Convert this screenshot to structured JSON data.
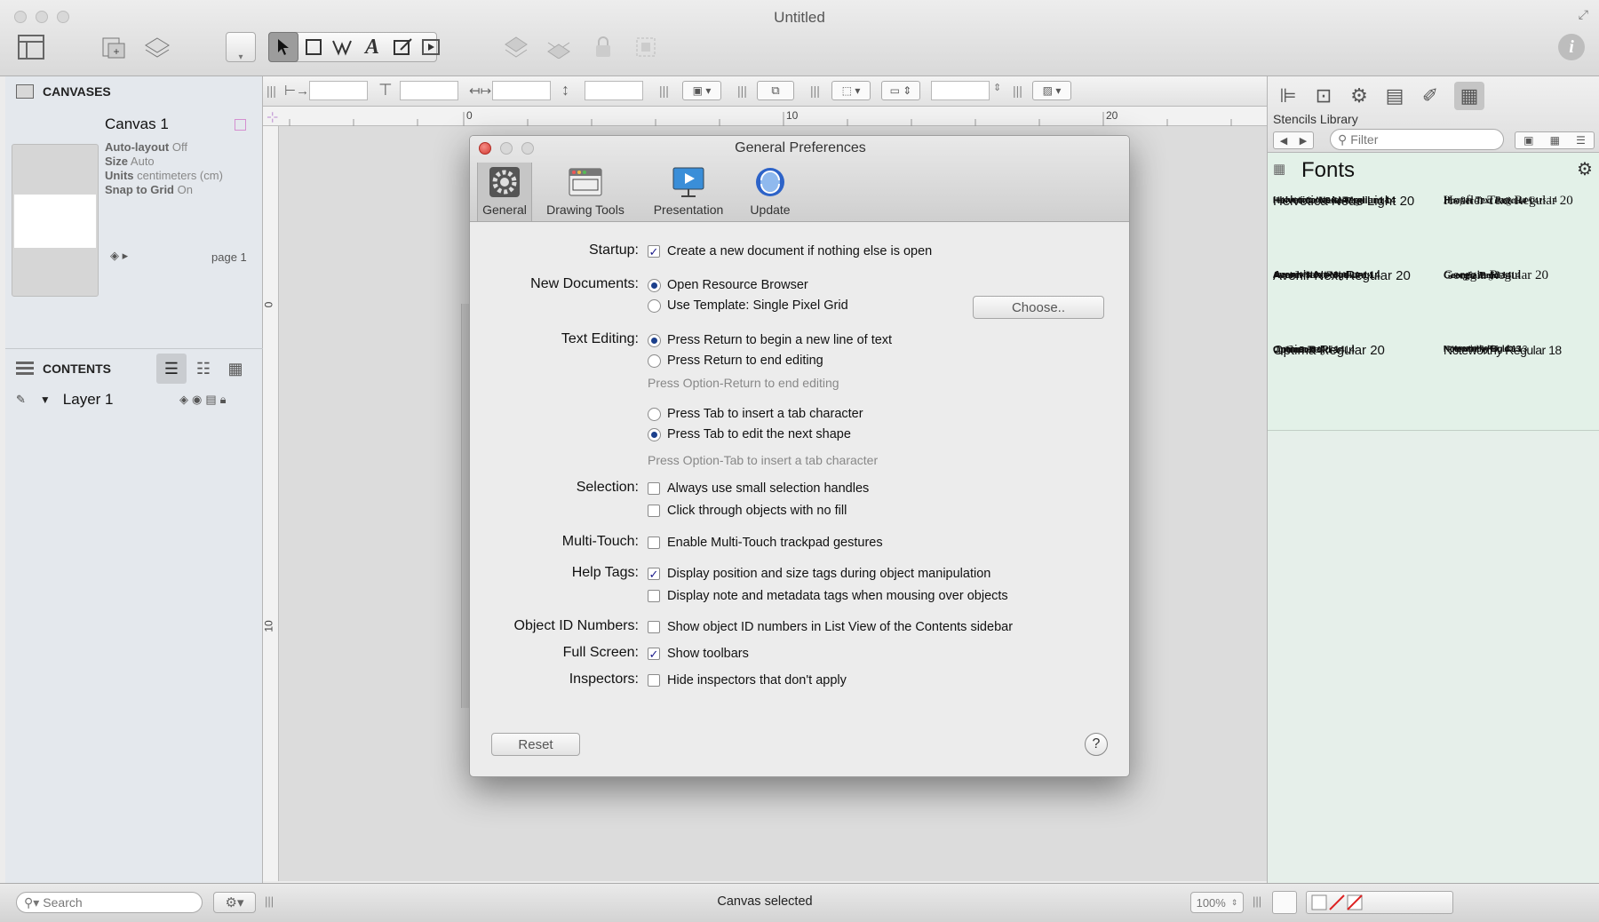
{
  "window": {
    "title": "Untitled"
  },
  "sidebar": {
    "canvases_header": "CANVASES",
    "canvas": {
      "name": "Canvas 1",
      "meta": [
        {
          "key": "Auto-layout",
          "value": "Off"
        },
        {
          "key": "Size",
          "value": "Auto"
        },
        {
          "key": "Units",
          "value": "centimeters (cm)"
        },
        {
          "key": "Snap to Grid",
          "value": "On"
        }
      ],
      "page_label": "page 1"
    },
    "contents_header": "CONTENTS",
    "layer_name": "Layer 1",
    "search_placeholder": "Search"
  },
  "ruler": {
    "marks": [
      "0",
      "10",
      "20"
    ],
    "vmarks": [
      "0",
      "10"
    ]
  },
  "right_panel": {
    "title": "Stencils Library",
    "filter_placeholder": "Filter",
    "section_title": "Fonts",
    "font_groups": [
      {
        "lines": [
          "Helvetica Neue Light 20",
          "Helvetica Neue Medium 14",
          "Helvetica Neue Regular 14",
          "Helvetica Neue Bold 10"
        ]
      },
      {
        "lines": [
          "Hoefler Text Regular 20",
          "Hoefler Text Regular Caps 14",
          "Hoefler Text Regular 14",
          "Hoefler Text Italic 14"
        ]
      },
      {
        "lines": [
          "Avenir Next Regular 20",
          "Avenir Next Medium 14",
          "Avenir Next Regular 14",
          "Avenir Next Demi Bold 10"
        ]
      },
      {
        "lines": [
          "Georgia Regular 20",
          "Georgia Bold 14",
          "Georgia Regular 14",
          "Georgia Italic 14"
        ]
      },
      {
        "lines": [
          "Optima Regular 20",
          "Optima Bold 14",
          "Optima Regular 14",
          "Optima Bold 10"
        ]
      },
      {
        "lines": [
          "Noteworthy Regular 18",
          "Noteworthy Bold 13",
          "Noteworthy Regular 13",
          "Noteworthy Bold 9"
        ]
      }
    ]
  },
  "status": {
    "text": "Canvas selected",
    "zoom": "100%"
  },
  "dialog": {
    "title": "General Preferences",
    "tabs": [
      "General",
      "Drawing Tools",
      "Presentation",
      "Update"
    ],
    "labels": {
      "startup": "Startup:",
      "new_documents": "New Documents:",
      "text_editing": "Text Editing:",
      "selection": "Selection:",
      "multitouch": "Multi-Touch:",
      "help_tags": "Help Tags:",
      "object_id": "Object ID Numbers:",
      "full_screen": "Full Screen:",
      "inspectors": "Inspectors:"
    },
    "options": {
      "startup_new": "Create a new document if nothing else is open",
      "open_resource": "Open Resource Browser",
      "use_template": "Use Template: Single Pixel Grid",
      "return_newline": "Press Return to begin a new line of text",
      "return_end": "Press Return to end editing",
      "option_return_hint": "Press Option-Return to end editing",
      "tab_insert": "Press Tab to insert a tab character",
      "tab_next": "Press Tab to edit the next shape",
      "option_tab_hint": "Press Option-Tab to insert a tab character",
      "small_handles": "Always use small selection handles",
      "click_through": "Click through objects with no fill",
      "multitouch_enable": "Enable Multi-Touch trackpad gestures",
      "display_position": "Display position and size tags during object manipulation",
      "display_note": "Display note and metadata tags when mousing over objects",
      "show_object_ids": "Show object ID numbers in List View of the Contents sidebar",
      "show_toolbars": "Show toolbars",
      "hide_inspectors": "Hide inspectors that don't apply"
    },
    "choose_button": "Choose..",
    "reset_button": "Reset",
    "help_button": "?"
  },
  "colors": {
    "accent": "#1b3f8c",
    "dialog_bg": "#ececec",
    "fonts_bg": "#e3f1e8",
    "close_red": "#e0443e"
  }
}
